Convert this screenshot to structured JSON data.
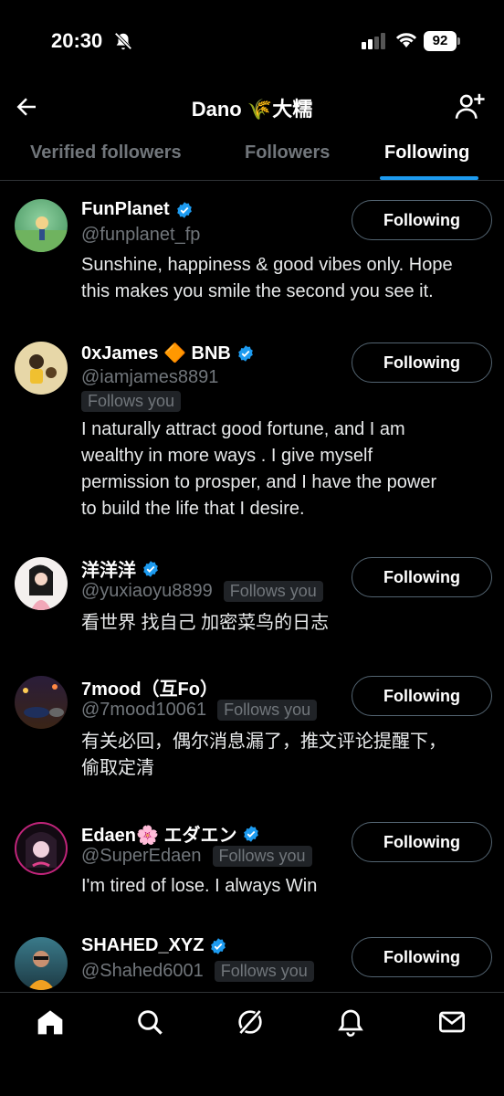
{
  "status_bar": {
    "time": "20:30",
    "battery": "92"
  },
  "header": {
    "title": "Dano 🌾大糯"
  },
  "tabs": [
    {
      "label": "Verified followers"
    },
    {
      "label": "Followers"
    },
    {
      "label": "Following"
    }
  ],
  "users": [
    {
      "name": "FunPlanet",
      "handle": "@funplanet_fp",
      "verified": true,
      "follows_you": false,
      "bio_lines": [
        "Sunshine, happiness & good vibes only. Hope",
        "this makes you smile the second you see it."
      ],
      "button": "Following"
    },
    {
      "name": "0xJames 🔶 BNB",
      "handle": "@iamjames8891",
      "verified": true,
      "follows_you": true,
      "follows_you_label": "Follows you",
      "bio_lines": [
        "I naturally attract good fortune, and I am",
        "wealthy in more ways . I give myself",
        "permission to prosper, and I have the power",
        "to build the life that I desire."
      ],
      "button": "Following"
    },
    {
      "name": "洋洋洋",
      "handle": "@yuxiaoyu8899",
      "verified": true,
      "follows_you": true,
      "follows_you_label": "Follows you",
      "bio_lines": [
        "看世界 找自己 加密菜鸟的日志"
      ],
      "button": "Following"
    },
    {
      "name": "7mood（互Fo）",
      "handle": "@7mood10061",
      "verified": false,
      "follows_you": true,
      "follows_you_label": "Follows you",
      "bio_lines": [
        "有关必回，偶尔消息漏了，推文评论提醒下，",
        "偷取定清"
      ],
      "button": "Following"
    },
    {
      "name": "Edaen🌸 エダエン",
      "handle": "@SuperEdaen",
      "verified": true,
      "follows_you": true,
      "follows_you_label": "Follows you",
      "bio_lines": [
        "I'm tired of lose. I always Win"
      ],
      "button": "Following"
    },
    {
      "name": "SHAHED_XYZ",
      "handle": "@Shahed6001",
      "verified": true,
      "follows_you": true,
      "follows_you_label": "Follows you",
      "bio_lines": [],
      "button": "Following"
    }
  ],
  "colors": {
    "accent": "#1d9bf0",
    "background": "#000000",
    "secondary_text": "#71767b"
  },
  "bottom_nav": [
    {
      "icon": "home-icon"
    },
    {
      "icon": "search-icon"
    },
    {
      "icon": "grok-icon"
    },
    {
      "icon": "notifications-icon"
    },
    {
      "icon": "messages-icon"
    }
  ]
}
